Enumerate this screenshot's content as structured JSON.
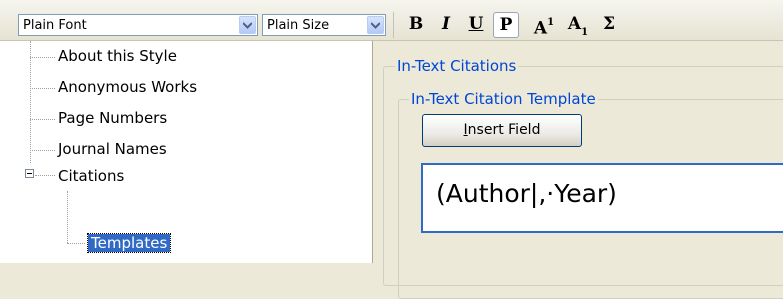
{
  "toolbar": {
    "font_combo": {
      "value": "Plain Font"
    },
    "size_combo": {
      "value": "Plain Size"
    },
    "buttons": {
      "bold": "B",
      "italic": "I",
      "underline": "U",
      "plain": "P",
      "superscript_base": "A",
      "superscript_mark": "1",
      "subscript_base": "A",
      "subscript_mark": "1",
      "symbol": "Σ"
    }
  },
  "tree": {
    "items": [
      {
        "label": "About this Style"
      },
      {
        "label": "Anonymous Works"
      },
      {
        "label": "Page Numbers"
      },
      {
        "label": "Journal Names"
      },
      {
        "label": "Citations",
        "expanded": true
      },
      {
        "label": "Templates",
        "selected": true
      }
    ]
  },
  "panel": {
    "group_title": "In-Text Citations",
    "subgroup_title": "In-Text Citation Template",
    "insert_button": {
      "mnemonic": "I",
      "rest": "nsert Field"
    },
    "template_text": "(Author|,·Year)"
  }
}
